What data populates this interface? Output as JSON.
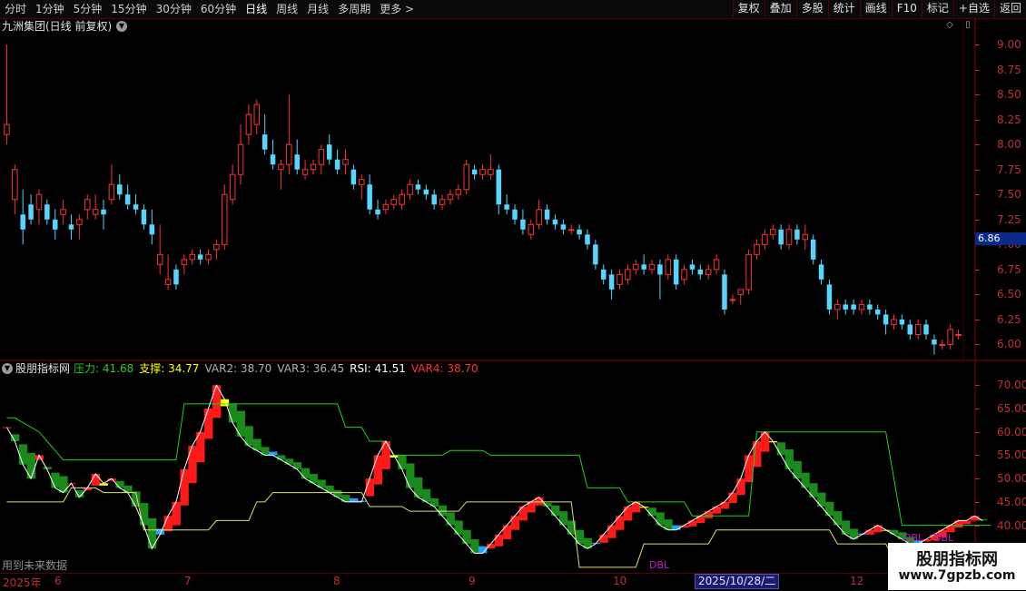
{
  "toolbar": {
    "periods": [
      "分时",
      "1分钟",
      "5分钟",
      "15分钟",
      "30分钟",
      "60分钟",
      "日线",
      "周线",
      "月线",
      "多周期",
      "更多 >"
    ],
    "active_period": "日线",
    "tools": [
      "复权",
      "叠加",
      "多股",
      "统计",
      "画线",
      "F10",
      "标记",
      "+自选",
      "返回"
    ]
  },
  "main_chart": {
    "title": "九洲集团(日线 前复权)",
    "current_price": "6.86",
    "price_ticks": [
      "9.00",
      "8.75",
      "8.50",
      "8.25",
      "8.00",
      "7.75",
      "7.50",
      "7.25",
      "7.00",
      "6.75",
      "6.50",
      "6.25",
      "6.00"
    ],
    "up_color": "#ff3232",
    "down_color": "#54d6ff"
  },
  "indicator": {
    "name": "股朋指标网",
    "values": [
      {
        "label": "压力:",
        "value": "41.68",
        "color": "#20d020"
      },
      {
        "label": "支撑:",
        "value": "34.77",
        "color": "#ffff00"
      },
      {
        "label": "VAR2:",
        "value": "38.70",
        "color": "#b0b0b0"
      },
      {
        "label": "VAR3:",
        "value": "36.45",
        "color": "#b0b0b0"
      },
      {
        "label": "RSI:",
        "value": "41.51",
        "color": "#ffffff"
      },
      {
        "label": "VAR4:",
        "value": "38.70",
        "color": "#ff3030"
      }
    ],
    "ticks": [
      "70.00",
      "65.00",
      "60.00",
      "55.00",
      "50.00",
      "45.00",
      "40.00",
      "35.00"
    ],
    "dbl_labels": [
      "DBL",
      "DBL",
      "DBL"
    ],
    "future_note": "用到未来数据"
  },
  "chart_data": {
    "type": "candlestick",
    "ylim": [
      5.85,
      9.1
    ],
    "candles": [
      [
        8.1,
        9.0,
        8.0,
        8.2
      ],
      [
        7.45,
        7.8,
        7.3,
        7.75
      ],
      [
        7.3,
        7.55,
        7.0,
        7.15
      ],
      [
        7.4,
        7.5,
        7.2,
        7.25
      ],
      [
        7.35,
        7.55,
        7.2,
        7.5
      ],
      [
        7.4,
        7.45,
        7.2,
        7.25
      ],
      [
        7.25,
        7.35,
        7.05,
        7.15
      ],
      [
        7.3,
        7.45,
        7.2,
        7.35
      ],
      [
        7.2,
        7.3,
        7.05,
        7.15
      ],
      [
        7.2,
        7.3,
        7.05,
        7.25
      ],
      [
        7.35,
        7.5,
        7.25,
        7.45
      ],
      [
        7.3,
        7.5,
        7.25,
        7.35
      ],
      [
        7.35,
        7.45,
        7.15,
        7.3
      ],
      [
        7.45,
        7.8,
        7.4,
        7.6
      ],
      [
        7.6,
        7.7,
        7.45,
        7.5
      ],
      [
        7.5,
        7.6,
        7.35,
        7.4
      ],
      [
        7.4,
        7.5,
        7.3,
        7.35
      ],
      [
        7.35,
        7.4,
        7.15,
        7.2
      ],
      [
        7.2,
        7.35,
        7.0,
        7.1
      ],
      [
        6.8,
        7.2,
        6.7,
        6.9
      ],
      [
        6.6,
        6.9,
        6.55,
        6.65
      ],
      [
        6.75,
        6.8,
        6.55,
        6.6
      ],
      [
        6.8,
        6.9,
        6.7,
        6.85
      ],
      [
        6.85,
        6.95,
        6.8,
        6.9
      ],
      [
        6.9,
        6.95,
        6.8,
        6.85
      ],
      [
        6.85,
        6.95,
        6.8,
        6.9
      ],
      [
        6.95,
        7.05,
        6.85,
        7.0
      ],
      [
        7.0,
        7.6,
        6.95,
        7.5
      ],
      [
        7.45,
        7.8,
        7.4,
        7.7
      ],
      [
        7.7,
        8.2,
        7.6,
        8.0
      ],
      [
        8.1,
        8.4,
        8.0,
        8.3
      ],
      [
        8.2,
        8.45,
        8.1,
        8.4
      ],
      [
        8.1,
        8.3,
        7.9,
        7.95
      ],
      [
        7.9,
        8.05,
        7.75,
        7.8
      ],
      [
        7.75,
        7.85,
        7.55,
        7.8
      ],
      [
        7.8,
        8.5,
        7.7,
        8.0
      ],
      [
        7.9,
        8.05,
        7.7,
        7.75
      ],
      [
        7.7,
        7.85,
        7.65,
        7.75
      ],
      [
        7.75,
        7.85,
        7.7,
        7.8
      ],
      [
        7.8,
        8.0,
        7.7,
        7.95
      ],
      [
        8.0,
        8.1,
        7.8,
        7.85
      ],
      [
        7.85,
        7.95,
        7.7,
        7.75
      ],
      [
        7.8,
        7.95,
        7.7,
        7.85
      ],
      [
        7.75,
        7.8,
        7.55,
        7.6
      ],
      [
        7.6,
        7.7,
        7.45,
        7.65
      ],
      [
        7.6,
        7.7,
        7.3,
        7.35
      ],
      [
        7.35,
        7.45,
        7.25,
        7.3
      ],
      [
        7.35,
        7.45,
        7.3,
        7.4
      ],
      [
        7.4,
        7.5,
        7.35,
        7.45
      ],
      [
        7.4,
        7.55,
        7.35,
        7.5
      ],
      [
        7.5,
        7.65,
        7.45,
        7.6
      ],
      [
        7.6,
        7.65,
        7.5,
        7.55
      ],
      [
        7.55,
        7.6,
        7.45,
        7.5
      ],
      [
        7.5,
        7.55,
        7.35,
        7.4
      ],
      [
        7.4,
        7.5,
        7.35,
        7.45
      ],
      [
        7.45,
        7.55,
        7.4,
        7.5
      ],
      [
        7.5,
        7.6,
        7.45,
        7.55
      ],
      [
        7.55,
        7.85,
        7.5,
        7.8
      ],
      [
        7.75,
        7.8,
        7.65,
        7.7
      ],
      [
        7.7,
        7.8,
        7.65,
        7.75
      ],
      [
        7.7,
        7.9,
        7.65,
        7.75
      ],
      [
        7.75,
        7.8,
        7.3,
        7.4
      ],
      [
        7.4,
        7.5,
        7.3,
        7.35
      ],
      [
        7.35,
        7.4,
        7.2,
        7.25
      ],
      [
        7.25,
        7.35,
        7.1,
        7.15
      ],
      [
        7.1,
        7.25,
        7.05,
        7.2
      ],
      [
        7.2,
        7.45,
        7.15,
        7.35
      ],
      [
        7.35,
        7.4,
        7.2,
        7.25
      ],
      [
        7.25,
        7.3,
        7.15,
        7.2
      ],
      [
        7.2,
        7.25,
        7.1,
        7.15
      ],
      [
        7.15,
        7.2,
        7.1,
        7.15
      ],
      [
        7.15,
        7.2,
        7.05,
        7.1
      ],
      [
        7.1,
        7.15,
        6.95,
        7.0
      ],
      [
        7.0,
        7.05,
        6.75,
        6.8
      ],
      [
        6.75,
        6.8,
        6.6,
        6.65
      ],
      [
        6.7,
        6.75,
        6.45,
        6.55
      ],
      [
        6.6,
        6.75,
        6.55,
        6.7
      ],
      [
        6.65,
        6.8,
        6.6,
        6.75
      ],
      [
        6.75,
        6.85,
        6.7,
        6.8
      ],
      [
        6.8,
        6.9,
        6.7,
        6.75
      ],
      [
        6.75,
        6.85,
        6.7,
        6.8
      ],
      [
        6.8,
        6.85,
        6.45,
        6.7
      ],
      [
        6.7,
        6.9,
        6.65,
        6.85
      ],
      [
        6.85,
        6.9,
        6.55,
        6.6
      ],
      [
        6.65,
        6.8,
        6.6,
        6.75
      ],
      [
        6.8,
        6.85,
        6.7,
        6.75
      ],
      [
        6.75,
        6.8,
        6.65,
        6.7
      ],
      [
        6.7,
        6.8,
        6.65,
        6.75
      ],
      [
        6.75,
        6.9,
        6.7,
        6.85
      ],
      [
        6.7,
        6.75,
        6.3,
        6.35
      ],
      [
        6.45,
        6.5,
        6.4,
        6.45
      ],
      [
        6.5,
        6.55,
        6.4,
        6.55
      ],
      [
        6.55,
        6.95,
        6.5,
        6.9
      ],
      [
        6.9,
        7.05,
        6.85,
        7.0
      ],
      [
        7.0,
        7.15,
        6.95,
        7.1
      ],
      [
        7.1,
        7.2,
        7.05,
        7.15
      ],
      [
        7.15,
        7.2,
        6.95,
        7.0
      ],
      [
        7.0,
        7.2,
        6.95,
        7.15
      ],
      [
        7.15,
        7.2,
        7.0,
        7.05
      ],
      [
        7.05,
        7.2,
        6.95,
        7.1
      ],
      [
        7.05,
        7.1,
        6.8,
        6.85
      ],
      [
        6.8,
        6.85,
        6.6,
        6.65
      ],
      [
        6.6,
        6.65,
        6.3,
        6.35
      ],
      [
        6.35,
        6.45,
        6.25,
        6.4
      ],
      [
        6.4,
        6.45,
        6.3,
        6.35
      ],
      [
        6.4,
        6.45,
        6.3,
        6.35
      ],
      [
        6.35,
        6.45,
        6.3,
        6.4
      ],
      [
        6.4,
        6.45,
        6.3,
        6.35
      ],
      [
        6.35,
        6.4,
        6.25,
        6.3
      ],
      [
        6.3,
        6.35,
        6.1,
        6.2
      ],
      [
        6.2,
        6.3,
        6.15,
        6.25
      ],
      [
        6.25,
        6.3,
        6.15,
        6.2
      ],
      [
        6.2,
        6.25,
        6.05,
        6.1
      ],
      [
        6.1,
        6.25,
        6.05,
        6.2
      ],
      [
        6.2,
        6.25,
        6.05,
        6.1
      ],
      [
        6.05,
        6.1,
        5.9,
        6.0
      ],
      [
        6.0,
        6.05,
        5.95,
        6.0
      ],
      [
        6.0,
        6.2,
        5.95,
        6.15
      ],
      [
        6.1,
        6.15,
        6.05,
        6.1
      ]
    ],
    "indicator_ylim": [
      30,
      72
    ],
    "resistance_line": [
      63,
      63,
      62,
      61,
      60,
      58,
      56,
      54,
      54,
      54,
      54,
      54,
      54,
      54,
      54,
      54,
      54,
      54,
      54,
      54,
      54,
      54,
      66,
      66,
      66,
      66,
      66,
      66,
      66,
      66,
      66,
      66,
      66,
      66,
      66,
      66,
      66,
      66,
      66,
      66,
      66,
      66,
      61,
      61,
      61,
      58,
      58,
      58,
      55,
      55,
      55,
      55,
      55,
      55,
      55,
      56,
      56,
      56,
      56,
      56,
      55,
      55,
      55,
      55,
      55,
      55,
      55,
      55,
      55,
      55,
      55,
      55,
      48,
      48,
      48,
      48,
      48,
      45,
      45,
      45,
      45,
      45,
      45,
      45,
      45,
      42,
      42,
      42,
      42,
      42,
      42,
      42,
      42,
      60,
      60,
      60,
      60,
      60,
      60,
      60,
      60,
      60,
      60,
      60,
      60,
      60,
      60,
      60,
      60,
      60,
      50,
      40,
      40,
      40,
      40,
      40,
      40,
      40,
      40,
      40,
      40,
      40,
      40
    ],
    "support_line": [
      45,
      45,
      45,
      45,
      45,
      45,
      45,
      45,
      48,
      48,
      48,
      48,
      47,
      47,
      47,
      47,
      47,
      39,
      39,
      39,
      39,
      39,
      39,
      39,
      39,
      39,
      41,
      41,
      41,
      41,
      41,
      45,
      45,
      47,
      47,
      47,
      47,
      47,
      47,
      47,
      47,
      47,
      47,
      47,
      47,
      44,
      44,
      44,
      44,
      44,
      43,
      43,
      43,
      43,
      43,
      43,
      43,
      45,
      45,
      45,
      45,
      45,
      45,
      45,
      45,
      45,
      45,
      45,
      45,
      45,
      45,
      31,
      31,
      31,
      31,
      31,
      31,
      31,
      31,
      36,
      36,
      36,
      36,
      36,
      36,
      36,
      36,
      36,
      39,
      39,
      39,
      39,
      39,
      39,
      39,
      39,
      39,
      39,
      39,
      39,
      39,
      39,
      39,
      36,
      36,
      36,
      36,
      36,
      36,
      36,
      33,
      33,
      33,
      33,
      33,
      33,
      33,
      33,
      33,
      33,
      33
    ],
    "rsi": [
      61,
      58,
      53,
      50,
      55,
      52,
      48,
      47,
      49,
      46,
      48,
      51,
      49,
      50,
      48,
      47,
      44,
      40,
      35,
      38,
      42,
      45,
      52,
      57,
      60,
      65,
      70,
      67,
      62,
      59,
      57,
      56,
      55,
      55,
      54,
      53,
      52,
      50,
      49,
      48,
      47,
      46,
      45,
      45,
      45,
      50,
      55,
      58,
      55,
      52,
      48,
      46,
      45,
      44,
      42,
      40,
      38,
      36,
      34,
      34,
      36,
      38,
      40,
      42,
      44,
      45,
      46,
      44,
      42,
      40,
      38,
      36,
      35,
      36,
      38,
      40,
      42,
      44,
      45,
      44,
      42,
      40,
      39,
      39,
      40,
      41,
      42,
      43,
      44,
      45,
      47,
      50,
      55,
      58,
      60,
      58,
      55,
      52,
      50,
      48,
      46,
      44,
      42,
      40,
      38,
      37,
      38,
      39,
      40,
      39,
      38,
      37,
      36,
      36,
      37,
      38,
      39,
      40,
      41,
      41,
      42,
      41
    ]
  }
}
